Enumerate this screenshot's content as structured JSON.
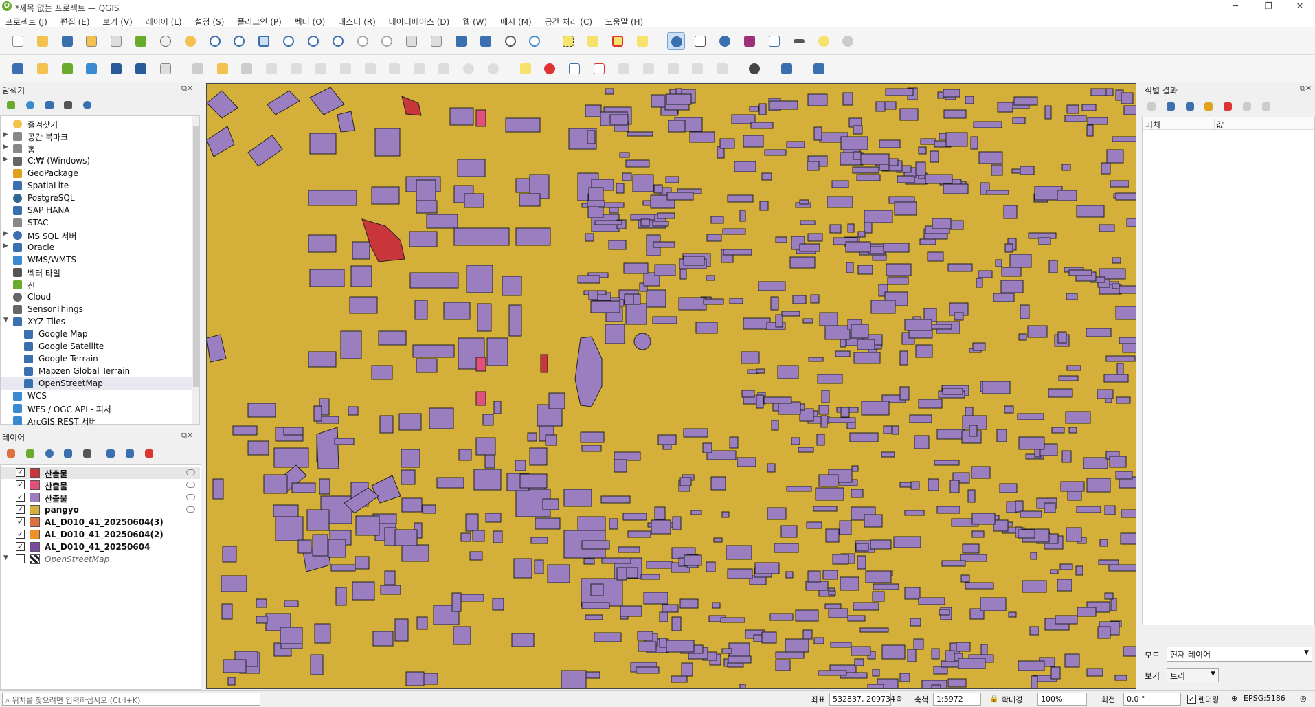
{
  "window": {
    "title": "*제목 없는 프로젝트 — QGIS",
    "minimize": "─",
    "restore": "❐",
    "close": "✕"
  },
  "menu": [
    "프로젝트 (J)",
    "편집 (E)",
    "보기 (V)",
    "레이어 (L)",
    "설정 (S)",
    "플러그인 (P)",
    "벡터 (O)",
    "래스터 (R)",
    "데이터베이스 (D)",
    "웹 (W)",
    "메시 (M)",
    "공간 처리 (C)",
    "도움말 (H)"
  ],
  "colors": {
    "map_bg": "#d4b03a",
    "building": "#9b7ec0",
    "highlight_red": "#c8353a",
    "highlight_pink": "#e0507a"
  },
  "browser": {
    "title": "탐색기",
    "items": [
      {
        "label": "즐겨찾기",
        "icon": "star-icon",
        "expand": false
      },
      {
        "label": "공간 북마크",
        "icon": "bookmark-icon",
        "expand": true
      },
      {
        "label": "홈",
        "icon": "home-folder-icon",
        "expand": true
      },
      {
        "label": "C:₩ (Windows)",
        "icon": "drive-icon",
        "expand": true
      },
      {
        "label": "GeoPackage",
        "icon": "geopackage-icon",
        "expand": false
      },
      {
        "label": "SpatiaLite",
        "icon": "spatialite-icon",
        "expand": false
      },
      {
        "label": "PostgreSQL",
        "icon": "postgresql-icon",
        "expand": false
      },
      {
        "label": "SAP HANA",
        "icon": "sap-hana-icon",
        "expand": false
      },
      {
        "label": "STAC",
        "icon": "stac-icon",
        "expand": false
      },
      {
        "label": "MS SQL 서버",
        "icon": "mssql-icon",
        "expand": true
      },
      {
        "label": "Oracle",
        "icon": "oracle-icon",
        "expand": true
      },
      {
        "label": "WMS/WMTS",
        "icon": "wms-icon",
        "expand": false
      },
      {
        "label": "벡터 타일",
        "icon": "vector-tile-icon",
        "expand": false
      },
      {
        "label": "신",
        "icon": "scene-icon",
        "expand": false
      },
      {
        "label": "Cloud",
        "icon": "cloud-icon",
        "expand": false
      },
      {
        "label": "SensorThings",
        "icon": "sensor-icon",
        "expand": false
      },
      {
        "label": "XYZ Tiles",
        "icon": "xyz-tiles-icon",
        "expand": true,
        "open": true
      },
      {
        "label": "Google Map",
        "icon": "xyz-tile-icon",
        "child": true
      },
      {
        "label": "Google Satellite",
        "icon": "xyz-tile-icon",
        "child": true
      },
      {
        "label": "Google Terrain",
        "icon": "xyz-tile-icon",
        "child": true
      },
      {
        "label": "Mapzen Global Terrain",
        "icon": "xyz-tile-icon",
        "child": true
      },
      {
        "label": "OpenStreetMap",
        "icon": "xyz-tile-icon",
        "child": true,
        "selected": true
      },
      {
        "label": "WCS",
        "icon": "wcs-icon",
        "expand": false
      },
      {
        "label": "WFS / OGC API - 피처",
        "icon": "wfs-icon",
        "expand": false
      },
      {
        "label": "ArcGIS REST 서버",
        "icon": "arcgis-icon",
        "expand": false
      }
    ]
  },
  "layers": {
    "title": "레이어",
    "items": [
      {
        "label": "산출물",
        "color": "#c8353a",
        "checked": true,
        "selected": true,
        "filter": true
      },
      {
        "label": "산출물",
        "color": "#e0507a",
        "checked": true,
        "filter": true
      },
      {
        "label": "산출물",
        "color": "#9b7ec0",
        "checked": true,
        "filter": true
      },
      {
        "label": "pangyo",
        "color": "#d4b03a",
        "checked": true,
        "filter": true
      },
      {
        "label": "AL_D010_41_20250604(3)",
        "color": "#e07040",
        "checked": true
      },
      {
        "label": "AL_D010_41_20250604(2)",
        "color": "#f0902a",
        "checked": true
      },
      {
        "label": "AL_D010_41_20250604",
        "color": "#7a4a9a",
        "checked": true
      },
      {
        "label": "OpenStreetMap",
        "color": "#ffffff",
        "checked": false,
        "italic": true
      }
    ]
  },
  "identify": {
    "title": "식별 결과",
    "col_feature": "피처",
    "col_value": "값",
    "mode_label": "모드",
    "mode_value": "현재 레이어",
    "view_label": "보기",
    "view_value": "트리"
  },
  "status": {
    "locator_placeholder": "위치를 찾으려면 입력하십시오 (Ctrl+K)",
    "coord_label": "좌표",
    "coord_value": "532837, 209734",
    "scale_label": "축척",
    "scale_value": "1:5972",
    "magnifier_label": "확대경",
    "magnifier_value": "100%",
    "rotation_label": "회전",
    "rotation_value": "0.0 °",
    "render_label": "렌더링",
    "crs": "EPSG:5186"
  }
}
